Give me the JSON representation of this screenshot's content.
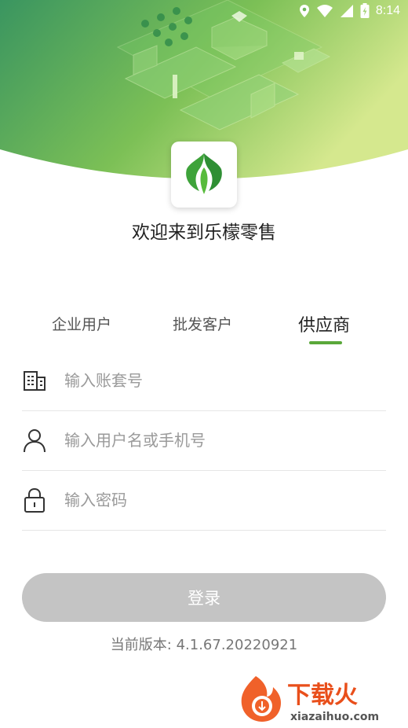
{
  "status_bar": {
    "time": "8:14"
  },
  "hero": {
    "illustration": "isometric-green-farm-retail-scene"
  },
  "app": {
    "logo_icon": "leaf-logo-icon",
    "welcome": "欢迎来到乐檬零售"
  },
  "tabs": [
    {
      "label": "企业用户",
      "active": false
    },
    {
      "label": "批发客户",
      "active": false
    },
    {
      "label": "供应商",
      "active": true
    }
  ],
  "form": {
    "account_placeholder": "输入账套号",
    "username_placeholder": "输入用户名或手机号",
    "password_placeholder": "输入密码",
    "login_label": "登录"
  },
  "version": "当前版本: 4.1.67.20220921",
  "watermark": {
    "text": "下载火",
    "url": "xiazaihuo.com"
  },
  "colors": {
    "accent": "#5aa83a",
    "hero_dark": "#3d9a5a",
    "hero_light": "#c2e08a",
    "button_disabled": "#c4c4c4"
  }
}
